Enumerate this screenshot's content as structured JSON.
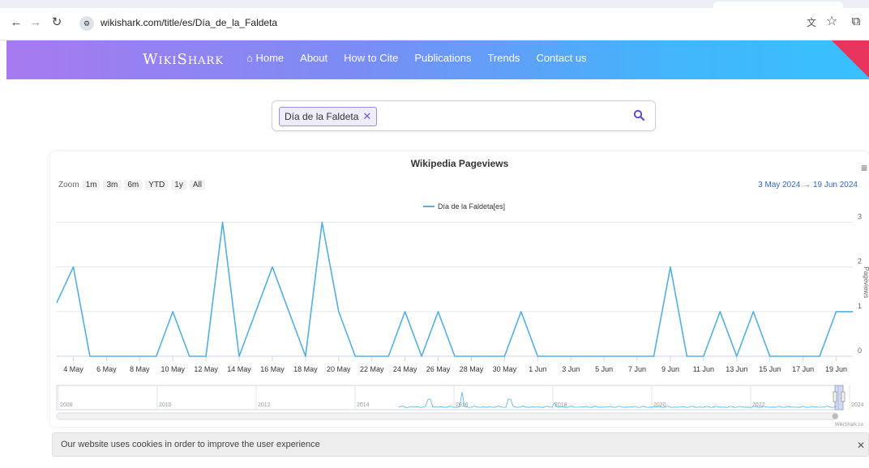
{
  "browser": {
    "url": "wikishark.com/title/es/Día_de_la_Faldeta",
    "icons": {
      "back": "back-arrow-icon",
      "forward": "forward-arrow-icon",
      "reload": "reload-icon",
      "site_info": "site-info-icon",
      "translate": "translate-icon",
      "bookmark": "star-icon",
      "extensions": "extensions-icon"
    }
  },
  "site": {
    "brand": "WikiShark",
    "nav": [
      {
        "label": "Home",
        "icon": "home-icon"
      },
      {
        "label": "About"
      },
      {
        "label": "How to Cite"
      },
      {
        "label": "Publications"
      },
      {
        "label": "Trends"
      },
      {
        "label": "Contact us"
      }
    ]
  },
  "search": {
    "tag": "Día de la Faldeta",
    "icon": "search-icon"
  },
  "chart_panel": {
    "title": "Wikipedia Pageviews",
    "zoom_label": "Zoom",
    "zoom_buttons": [
      "1m",
      "3m",
      "6m",
      "YTD",
      "1y",
      "All"
    ],
    "range_from": "3 May 2024",
    "range_arrow": "→",
    "range_to": "19 Jun 2024",
    "menu_icon": "hamburger-icon"
  },
  "chart_data": {
    "type": "line",
    "title": "Wikipedia Pageviews",
    "ylabel": "Pageviews",
    "ylim": [
      0,
      3.5
    ],
    "yticks": [
      0,
      1,
      2,
      3
    ],
    "grid": true,
    "legend_position": "top-center",
    "series": [
      {
        "name": "Día de la Faldeta[es]",
        "color": "#4fb0e8",
        "x": [
          "3 May",
          "4 May",
          "5 May",
          "6 May",
          "7 May",
          "8 May",
          "9 May",
          "10 May",
          "11 May",
          "12 May",
          "13 May",
          "14 May",
          "15 May",
          "16 May",
          "17 May",
          "18 May",
          "19 May",
          "20 May",
          "21 May",
          "22 May",
          "23 May",
          "24 May",
          "25 May",
          "26 May",
          "27 May",
          "28 May",
          "29 May",
          "30 May",
          "31 May",
          "1 Jun",
          "2 Jun",
          "3 Jun",
          "4 Jun",
          "5 Jun",
          "6 Jun",
          "7 Jun",
          "8 Jun",
          "9 Jun",
          "10 Jun",
          "11 Jun",
          "12 Jun",
          "13 Jun",
          "14 Jun",
          "15 Jun",
          "16 Jun",
          "17 Jun",
          "18 Jun",
          "19 Jun",
          "20 Jun"
        ],
        "values": [
          1.2,
          2,
          0,
          0,
          0,
          0,
          0,
          1,
          0,
          0,
          3,
          0,
          1,
          2,
          1,
          0,
          3,
          1,
          0,
          0,
          0,
          1,
          0,
          1,
          0,
          0,
          0,
          0,
          1,
          0,
          0,
          0,
          0,
          0,
          0,
          0,
          0,
          2,
          0,
          0,
          1,
          0,
          1,
          0,
          0,
          0,
          0,
          1,
          1
        ]
      }
    ],
    "xtick_labels": [
      "4 May",
      "6 May",
      "8 May",
      "10 May",
      "12 May",
      "14 May",
      "16 May",
      "18 May",
      "20 May",
      "22 May",
      "24 May",
      "26 May",
      "28 May",
      "30 May",
      "1 Jun",
      "3 Jun",
      "5 Jun",
      "7 Jun",
      "9 Jun",
      "11 Jun",
      "13 Jun",
      "15 Jun",
      "17 Jun",
      "19 Jun"
    ],
    "ytick_labels": [
      "0",
      "1",
      "2",
      "3"
    ],
    "navigator": {
      "year_labels": [
        "2008",
        "2010",
        "2012",
        "2014",
        "2016",
        "2018",
        "2020",
        "2022",
        "2024"
      ]
    },
    "credit": "WikiShark.co"
  },
  "cookie": {
    "message": "Our website uses cookies in order to improve the user experience",
    "close_icon": "close-icon"
  }
}
